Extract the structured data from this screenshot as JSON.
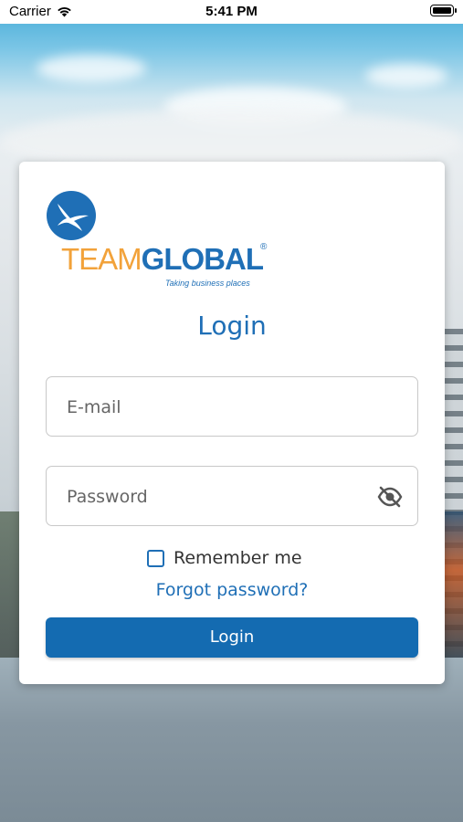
{
  "status_bar": {
    "carrier": "Carrier",
    "time": "5:41 PM"
  },
  "logo": {
    "team": "TEAM",
    "global": "GLOBAL",
    "registered": "®",
    "tagline": "Taking business places"
  },
  "login": {
    "title": "Login",
    "email_placeholder": "E-mail",
    "password_placeholder": "Password",
    "remember_me_label": "Remember me",
    "remember_me_checked": false,
    "forgot_password_label": "Forgot password?",
    "login_button_label": "Login"
  },
  "icons": {
    "wifi": "wifi-icon",
    "battery": "battery-icon",
    "password_visibility": "eye-off-icon",
    "logo_bird": "bird-icon"
  },
  "colors": {
    "brand_blue": "#1f6fb6",
    "brand_orange": "#f2a23a",
    "button_blue": "#146bb1"
  }
}
